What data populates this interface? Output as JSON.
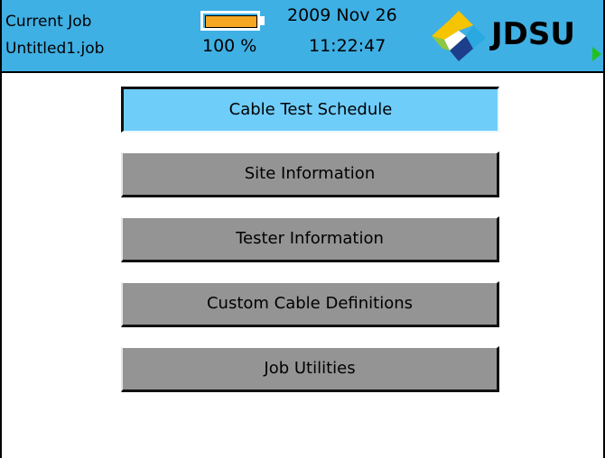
{
  "header": {
    "job_label": "Current Job",
    "job_name": "Untitled1.job",
    "battery": {
      "percent_label": "100 %",
      "level_fraction": 1.0,
      "fill_color": "#f5a623"
    },
    "date": "2009 Nov 26",
    "time": "11:22:47",
    "logo_text": "JDSU",
    "background_color": "#3fb0e4"
  },
  "menu": {
    "items": [
      {
        "label": "Cable Test Schedule",
        "selected": true
      },
      {
        "label": "Site Information",
        "selected": false
      },
      {
        "label": "Tester Information",
        "selected": false
      },
      {
        "label": "Custom Cable Definitions",
        "selected": false
      },
      {
        "label": "Job Utilities",
        "selected": false
      }
    ],
    "selected_color": "#6fcdfa",
    "default_color": "#949494"
  },
  "icons": {
    "logo": "jdsu-logo-icon",
    "battery": "battery-icon",
    "corner_indicator": "green-arrow-icon"
  }
}
